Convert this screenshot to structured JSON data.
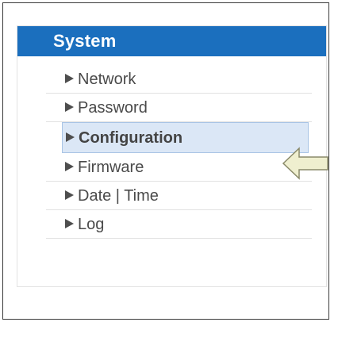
{
  "panel": {
    "title": "System",
    "header_color": "#1b6fbe"
  },
  "menu": {
    "items": [
      {
        "label": "Network",
        "icon": "triangle-right-icon"
      },
      {
        "label": "Password",
        "icon": "triangle-right-icon"
      },
      {
        "label": "Configuration",
        "icon": "triangle-right-icon",
        "selected": true
      },
      {
        "label": "Firmware",
        "icon": "triangle-right-icon"
      },
      {
        "label": "Date | Time",
        "icon": "triangle-right-icon"
      },
      {
        "label": "Log",
        "icon": "triangle-right-icon"
      }
    ]
  },
  "annotation": {
    "icon": "left-arrow-pointer-icon",
    "fill": "#efefcf",
    "stroke": "#8a8a6a"
  }
}
